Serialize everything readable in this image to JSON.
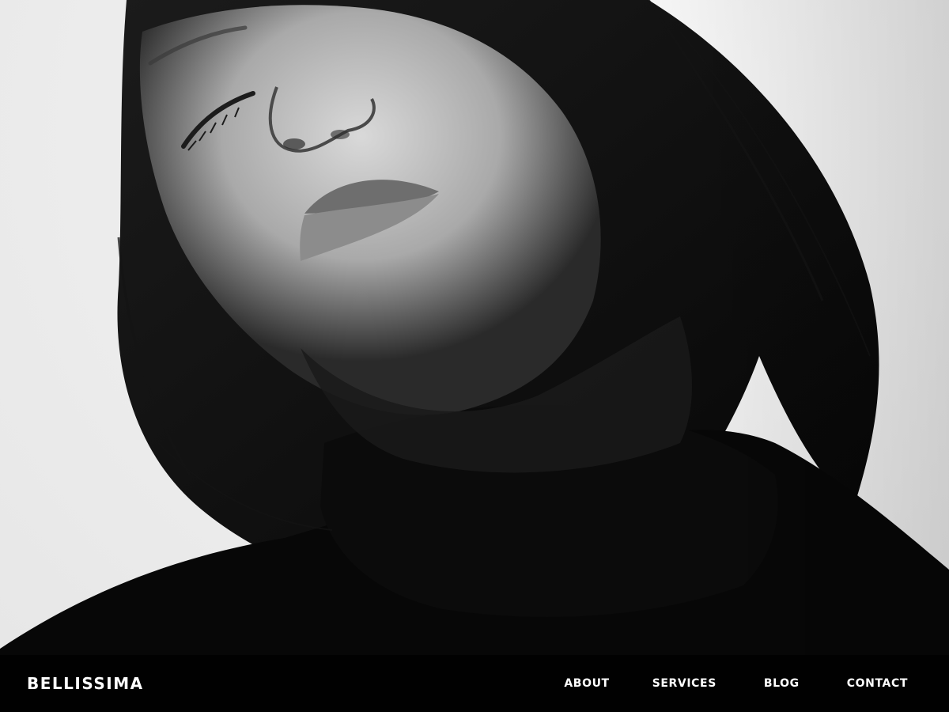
{
  "site": {
    "brand": "BELLISSIMA"
  },
  "nav": {
    "items": [
      {
        "label": "ABOUT"
      },
      {
        "label": "SERVICES"
      },
      {
        "label": "BLOG"
      },
      {
        "label": "CONTACT"
      }
    ]
  },
  "theme": {
    "navbar_bg": "#000000",
    "nav_text": "#ffffff"
  }
}
